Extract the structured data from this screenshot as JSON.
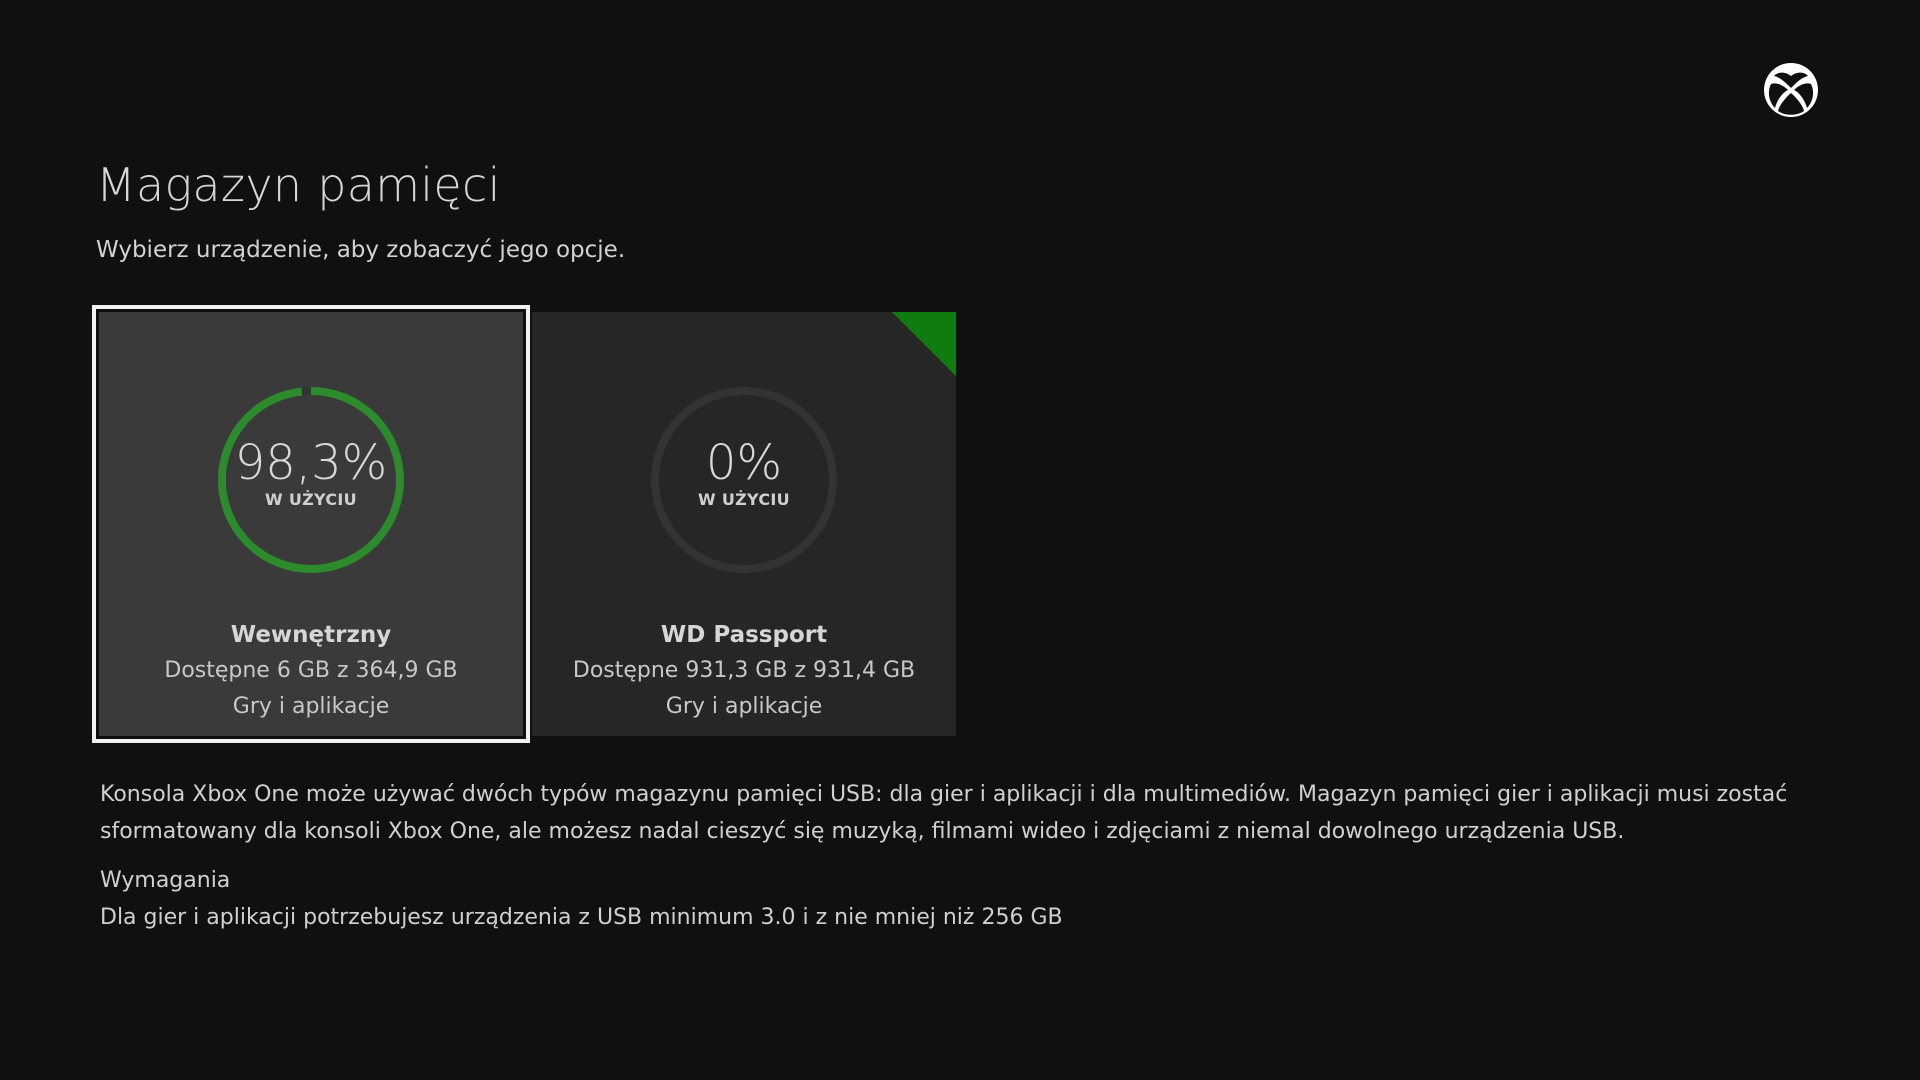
{
  "colors": {
    "background": "#101010",
    "accent_green": "#107c10",
    "ring_track": "#333333"
  },
  "header": {
    "logo_icon": "xbox-logo-icon",
    "title": "Magazyn pamięci",
    "subtitle": "Wybierz urządzenie, aby zobaczyć jego opcje."
  },
  "devices": [
    {
      "name": "Wewnętrzny",
      "usage_percent_text": "98,3%",
      "usage_fraction": 0.983,
      "usage_label": "W UŻYCIU",
      "available": "Dostępne 6 GB z 364,9 GB",
      "type": "Gry i aplikacje",
      "selected": true
    },
    {
      "name": "WD Passport",
      "usage_percent_text": "0%",
      "usage_fraction": 0,
      "usage_label": "W UŻYCIU",
      "available": "Dostępne 931,3 GB z 931,4 GB",
      "type": "Gry i aplikacje",
      "selected": false,
      "badge": "green-corner-badge"
    }
  ],
  "info": {
    "description": "Konsola Xbox One może używać dwóch typów magazynu pamięci USB: dla gier i aplikacji i dla multimediów. Magazyn pamięci gier i aplikacji musi zostać sformatowany dla konsoli Xbox One, ale możesz nadal cieszyć się muzyką, filmami wideo i zdjęciami z niemal dowolnego urządzenia USB.",
    "requirements_title": "Wymagania",
    "requirements_text": "Dla gier i aplikacji potrzebujesz urządzenia z USB minimum 3.0 i z nie mniej niż 256 GB"
  }
}
